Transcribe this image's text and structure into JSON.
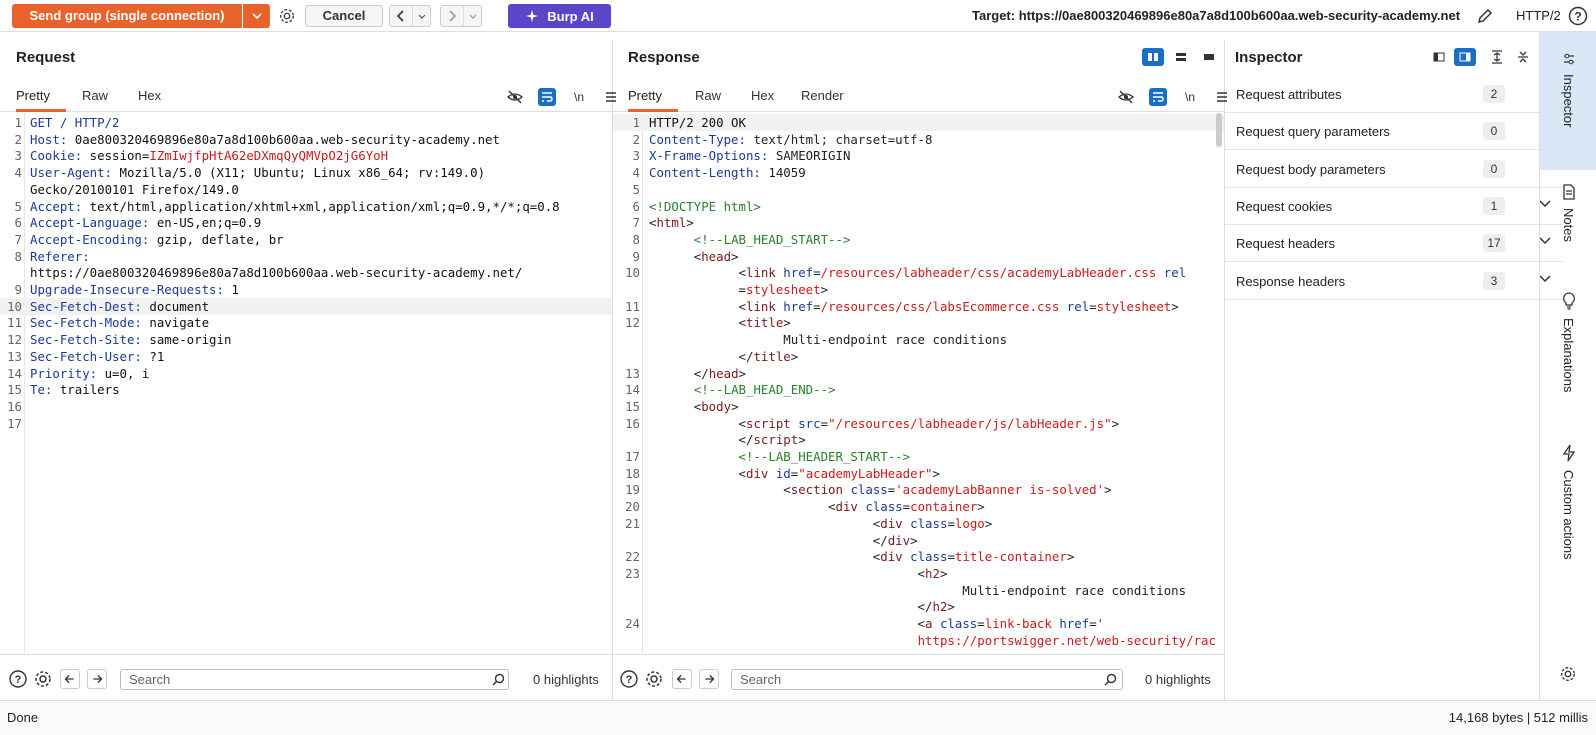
{
  "toolbar": {
    "send_label": "Send group (single connection)",
    "cancel_label": "Cancel",
    "burp_ai_label": "Burp AI",
    "target_label": "Target: https://0ae800320469896e80a7a8d100b600aa.web-security-academy.net",
    "protocol": "HTTP/2"
  },
  "request": {
    "title": "Request",
    "tabs": [
      "Pretty",
      "Raw",
      "Hex"
    ],
    "newline_toggle": "\\n",
    "lines": [
      {
        "n": "1",
        "k": "GET / HTTP/2",
        "v": ""
      },
      {
        "n": "2",
        "k": "Host:",
        "v": " 0ae800320469896e80a7a8d100b600aa.web-security-academy.net"
      },
      {
        "n": "3",
        "k": "Cookie:",
        "v": " session=",
        "r": "IZmIwjfpHtA62eDXmqQyQMVpO2jG6YoH"
      },
      {
        "n": "4",
        "k": "User-Agent:",
        "v": " Mozilla/5.0 (X11; Ubuntu; Linux x86_64; rv:149.0)"
      },
      {
        "n": "",
        "k": "",
        "v": "Gecko/20100101 Firefox/149.0"
      },
      {
        "n": "5",
        "k": "Accept:",
        "v": " text/html,application/xhtml+xml,application/xml;q=0.9,*/*;q=0.8"
      },
      {
        "n": "6",
        "k": "Accept-Language:",
        "v": " en-US,en;q=0.9"
      },
      {
        "n": "7",
        "k": "Accept-Encoding:",
        "v": " gzip, deflate, br"
      },
      {
        "n": "8",
        "k": "Referer:",
        "v": ""
      },
      {
        "n": "",
        "k": "",
        "v": "https://0ae800320469896e80a7a8d100b600aa.web-security-academy.net/"
      },
      {
        "n": "9",
        "k": "Upgrade-Insecure-Requests:",
        "v": " 1"
      },
      {
        "n": "10",
        "k": "Sec-Fetch-Dest:",
        "v": " document"
      },
      {
        "n": "11",
        "k": "Sec-Fetch-Mode:",
        "v": " navigate"
      },
      {
        "n": "12",
        "k": "Sec-Fetch-Site:",
        "v": " same-origin"
      },
      {
        "n": "13",
        "k": "Sec-Fetch-User:",
        "v": " ?1"
      },
      {
        "n": "14",
        "k": "Priority:",
        "v": " u=0, i"
      },
      {
        "n": "15",
        "k": "Te:",
        "v": " trailers"
      },
      {
        "n": "16",
        "k": "",
        "v": ""
      },
      {
        "n": "17",
        "k": "",
        "v": ""
      }
    ],
    "search_placeholder": "Search",
    "highlights": "0 highlights"
  },
  "response": {
    "title": "Response",
    "tabs": [
      "Pretty",
      "Raw",
      "Hex",
      "Render"
    ],
    "newline_toggle": "\\n",
    "lines": [
      {
        "n": "1",
        "html": "<span class='t'>HTTP/2 200 OK</span>"
      },
      {
        "n": "2",
        "html": "<span class='k'>Content-Type:</span> text/html; charset=utf-8"
      },
      {
        "n": "3",
        "html": "<span class='k'>X-Frame-Options:</span> SAMEORIGIN"
      },
      {
        "n": "4",
        "html": "<span class='k'>Content-Length:</span> 14059"
      },
      {
        "n": "5",
        "html": ""
      },
      {
        "n": "6",
        "html": "<span class='cm'>&lt;!DOCTYPE html&gt;</span>"
      },
      {
        "n": "7",
        "html": "&lt;<span class='tg'>html</span>&gt;"
      },
      {
        "n": "8",
        "html": "      <span class='cm'>&lt;!--LAB_HEAD_START--&gt;</span>"
      },
      {
        "n": "9",
        "html": "      &lt;<span class='tg'>head</span>&gt;"
      },
      {
        "n": "10",
        "html": "            &lt;<span class='tg'>link</span> <span class='at'>href</span>=<span class='av'>/resources/labheader/css/academyLabHeader.css</span> <span class='at'>rel</span>"
      },
      {
        "n": "",
        "html": "            =<span class='av'>stylesheet</span>&gt;"
      },
      {
        "n": "11",
        "html": "            &lt;<span class='tg'>link</span> <span class='at'>href</span>=<span class='av'>/resources/css/labsEcommerce.css</span> <span class='at'>rel</span>=<span class='av'>stylesheet</span>&gt;"
      },
      {
        "n": "12",
        "html": "            &lt;<span class='tg'>title</span>&gt;"
      },
      {
        "n": "",
        "html": "                  Multi-endpoint race conditions"
      },
      {
        "n": "",
        "html": "            &lt;/<span class='tg'>title</span>&gt;"
      },
      {
        "n": "13",
        "html": "      &lt;/<span class='tg'>head</span>&gt;"
      },
      {
        "n": "14",
        "html": "      <span class='cm'>&lt;!--LAB_HEAD_END--&gt;</span>"
      },
      {
        "n": "15",
        "html": "      &lt;<span class='tg'>body</span>&gt;"
      },
      {
        "n": "16",
        "html": "            &lt;<span class='tg'>script</span> <span class='at'>src</span>=<span class='av'>\"/resources/labheader/js/labHeader.js\"</span>&gt;"
      },
      {
        "n": "",
        "html": "            &lt;/<span class='tg'>script</span>&gt;"
      },
      {
        "n": "17",
        "html": "            <span class='cm'>&lt;!--LAB_HEADER_START--&gt;</span>"
      },
      {
        "n": "18",
        "html": "            &lt;<span class='tg'>div</span> <span class='at'>id</span>=<span class='av'>\"academyLabHeader\"</span>&gt;"
      },
      {
        "n": "19",
        "html": "                  &lt;<span class='tg'>section</span> <span class='at'>class</span>=<span class='av'>'academyLabBanner is-solved'</span>&gt;"
      },
      {
        "n": "20",
        "html": "                        &lt;<span class='tg'>div</span> <span class='at'>class</span>=<span class='av'>container</span>&gt;"
      },
      {
        "n": "21",
        "html": "                              &lt;<span class='tg'>div</span> <span class='at'>class</span>=<span class='av'>logo</span>&gt;"
      },
      {
        "n": "",
        "html": "                              &lt;/<span class='tg'>div</span>&gt;"
      },
      {
        "n": "22",
        "html": "                              &lt;<span class='tg'>div</span> <span class='at'>class</span>=<span class='av'>title-container</span>&gt;"
      },
      {
        "n": "23",
        "html": "                                    &lt;<span class='tg'>h2</span>&gt;"
      },
      {
        "n": "",
        "html": "                                          Multi-endpoint race conditions"
      },
      {
        "n": "",
        "html": "                                    &lt;/<span class='tg'>h2</span>&gt;"
      },
      {
        "n": "24",
        "html": "                                    &lt;<span class='tg'>a</span> <span class='at'>class</span>=<span class='av'>link-back</span> <span class='at'>href</span>=<span class='av'>'</span>"
      },
      {
        "n": "",
        "html": "                                    <span class='av'>https://portswigger.net/web-security/rac</span>"
      }
    ],
    "search_placeholder": "Search",
    "highlights": "0 highlights"
  },
  "inspector": {
    "title": "Inspector",
    "rows": [
      {
        "label": "Request attributes",
        "count": "2"
      },
      {
        "label": "Request query parameters",
        "count": "0"
      },
      {
        "label": "Request body parameters",
        "count": "0"
      },
      {
        "label": "Request cookies",
        "count": "1"
      },
      {
        "label": "Request headers",
        "count": "17"
      },
      {
        "label": "Response headers",
        "count": "3"
      }
    ]
  },
  "sidebar": {
    "tabs": [
      "Inspector",
      "Notes",
      "Explanations",
      "Custom actions"
    ]
  },
  "status": {
    "left": "Done",
    "right": "14,168 bytes | 512 millis"
  },
  "colors": {
    "accent": "#e8622c",
    "burp_ai": "#5a46c8",
    "active_icon": "#1a6fc4"
  }
}
